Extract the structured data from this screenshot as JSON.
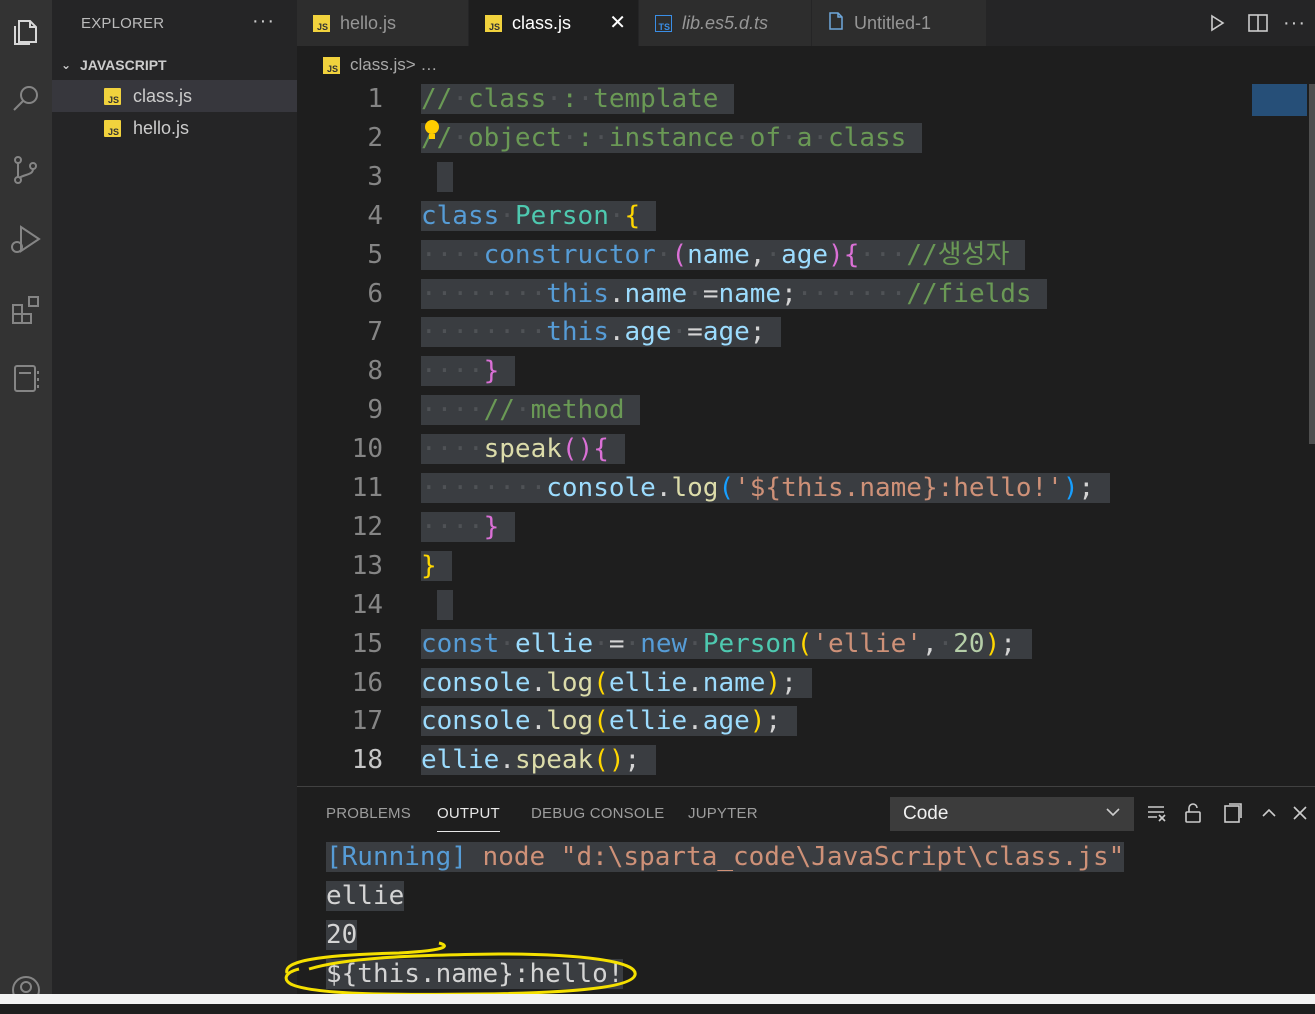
{
  "activity_bar": {
    "icons": [
      "explorer-icon",
      "search-icon",
      "source-control-icon",
      "run-debug-icon",
      "extensions-icon",
      "notebook-icon",
      "account-icon"
    ]
  },
  "sidebar": {
    "title": "EXPLORER",
    "more": "···",
    "section": "JAVASCRIPT",
    "files": [
      {
        "name": "class.js",
        "badge": "JS",
        "active": true
      },
      {
        "name": "hello.js",
        "badge": "JS",
        "active": false
      }
    ]
  },
  "tabs": [
    {
      "label": "hello.js",
      "type": "JS",
      "active": false
    },
    {
      "label": "class.js",
      "type": "JS",
      "active": true,
      "close": "✕"
    },
    {
      "label": "lib.es5.d.ts",
      "type": "TS",
      "active": false,
      "italic": true
    },
    {
      "label": "Untitled-1",
      "type": "file",
      "active": false
    }
  ],
  "breadcrumb": {
    "file": "class.js",
    "sep": " > …",
    "badge": "JS"
  },
  "editor": {
    "line_numbers": [
      "1",
      "2",
      "3",
      "4",
      "5",
      "6",
      "7",
      "8",
      "9",
      "10",
      "11",
      "12",
      "13",
      "14",
      "15",
      "16",
      "17",
      "18"
    ],
    "current_line": "18",
    "code": [
      "// class : template",
      "// object : instance of a class",
      "",
      "class Person {",
      "    constructor (name, age){   //생성자",
      "        this.name =name;       //fields",
      "        this.age =age;",
      "    }",
      "    // method",
      "    speak(){",
      "        console.log('${this.name}:hello!');",
      "    }",
      "}",
      "",
      "const ellie = new Person('ellie', 20);",
      "console.log(ellie.name);",
      "console.log(ellie.age);",
      "ellie.speak();"
    ]
  },
  "panel": {
    "tabs": [
      "PROBLEMS",
      "OUTPUT",
      "DEBUG CONSOLE",
      "JUPYTER"
    ],
    "active_tab": "OUTPUT",
    "output_select": "Code",
    "output": {
      "running_tag": "[Running]",
      "running_cmd": " node \"d:\\sparta_code\\JavaScript\\class.js\"",
      "lines": [
        "ellie",
        "20",
        "${this.name}:hello!"
      ]
    }
  },
  "colors": {
    "annotation": "#f5e000",
    "keyword": "#569cd6",
    "comment": "#6a9955",
    "string": "#ce9178"
  }
}
